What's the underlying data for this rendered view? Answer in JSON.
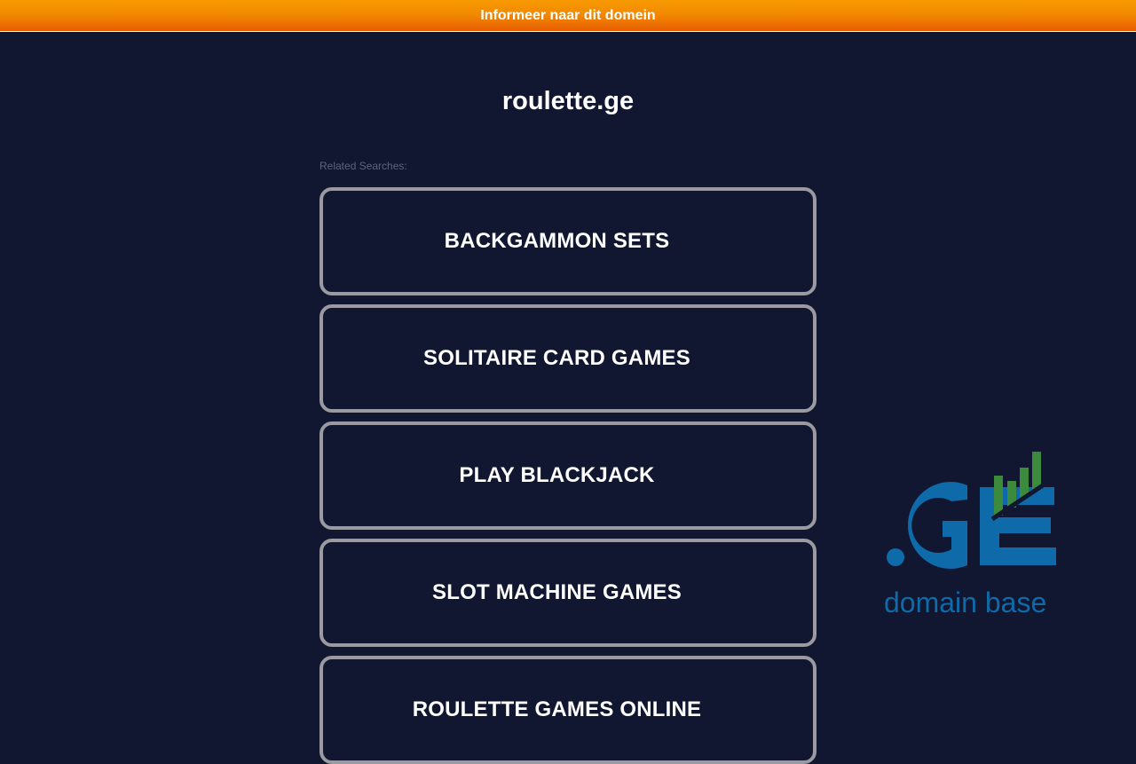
{
  "banner": {
    "text": "Informeer naar dit domein"
  },
  "page": {
    "domain": "roulette.ge",
    "related_label": "Related Searches:"
  },
  "related_searches": [
    "BACKGAMMON SETS",
    "SOLITAIRE CARD GAMES",
    "PLAY BLACKJACK",
    "SLOT MACHINE GAMES",
    "ROULETTE GAMES ONLINE"
  ],
  "logo": {
    "mark": ".GE",
    "tagline": "domain base",
    "colors": {
      "blue": "#0e6aa8",
      "green": "#3c8a3c"
    }
  },
  "colors": {
    "background": "#111730",
    "banner": "#f28a00",
    "box_border": "#9a9aa0",
    "text": "#ffffff",
    "muted_text": "#5d6380"
  }
}
